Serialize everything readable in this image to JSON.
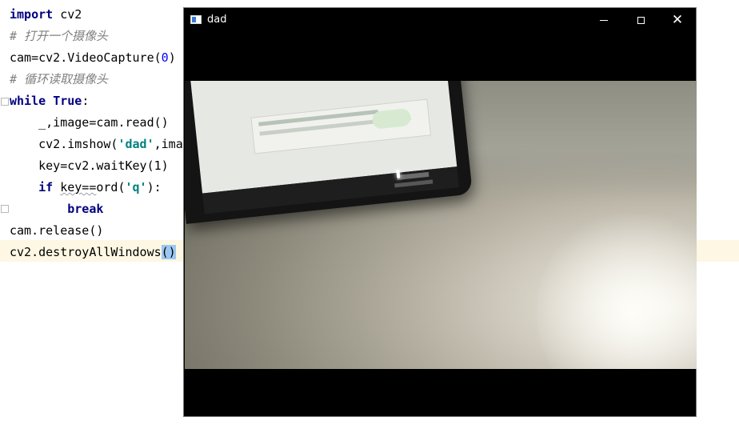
{
  "editor": {
    "lines": [
      {
        "kw": "import",
        "rest": " cv2"
      },
      {
        "comment": "# 打开一个摄像头"
      },
      {
        "pre": "cam=cv2.VideoCapture(",
        "num": "0",
        "post": ")"
      },
      {
        "comment": "# 循环读取摄像头"
      },
      {
        "kw": "while",
        "mid": " ",
        "kw2": "True",
        "post": ":"
      },
      {
        "indent": "    ",
        "text": "_,image=cam.read()"
      },
      {
        "indent": "    ",
        "pre": "cv2.imshow(",
        "str": "'dad'",
        "post": ",ima"
      },
      {
        "indent": "    ",
        "text": "key=cv2.waitKey(1)"
      },
      {
        "indent": "    ",
        "kw": "if",
        "sp": " ",
        "wavy": "key==",
        "pre": "ord(",
        "str": "'q'",
        "post": "):"
      },
      {
        "indent": "        ",
        "kw": "break"
      },
      {
        "text": "cam.release()"
      },
      {
        "pre": "cv2.destroyAllWindows",
        "paren": "()"
      }
    ]
  },
  "window": {
    "title": "dad",
    "icon": "app-window-icon",
    "controls": {
      "minimize": "minimize-icon",
      "maximize": "maximize-icon",
      "close": "✕"
    }
  },
  "colors": {
    "keyword": "#000080",
    "comment": "#808080",
    "number": "#0000ff",
    "string": "#008080",
    "caret_line": "#fdf7e3",
    "bracket_match": "#9cc7f0"
  }
}
